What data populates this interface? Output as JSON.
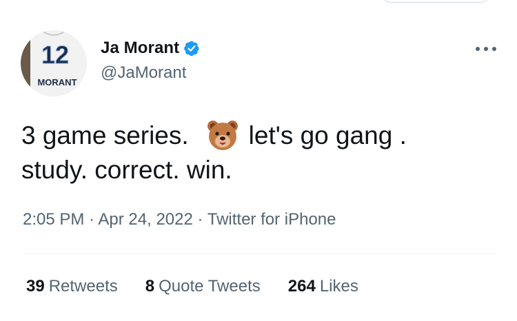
{
  "author": {
    "display_name": "Ja Morant",
    "handle": "@JaMorant",
    "verified": true,
    "avatar_jersey_number": "12",
    "avatar_jersey_name": "MORANT"
  },
  "tweet": {
    "line1_before_emoji": "3 game series.",
    "emoji": "bear-face",
    "line1_after_emoji": "let's go gang .",
    "line2": "study. correct. win."
  },
  "meta": {
    "time": "2:05 PM",
    "separator": " · ",
    "date": "Apr 24, 2022",
    "source": "Twitter for iPhone"
  },
  "stats": {
    "retweets_count": "39",
    "retweets_label": "Retweets",
    "quotes_count": "8",
    "quotes_label": "Quote Tweets",
    "likes_count": "264",
    "likes_label": "Likes"
  },
  "colors": {
    "text_primary": "#0f1419",
    "text_secondary": "#536471",
    "verified_blue": "#1d9bf0",
    "divider": "#eff3f4"
  }
}
